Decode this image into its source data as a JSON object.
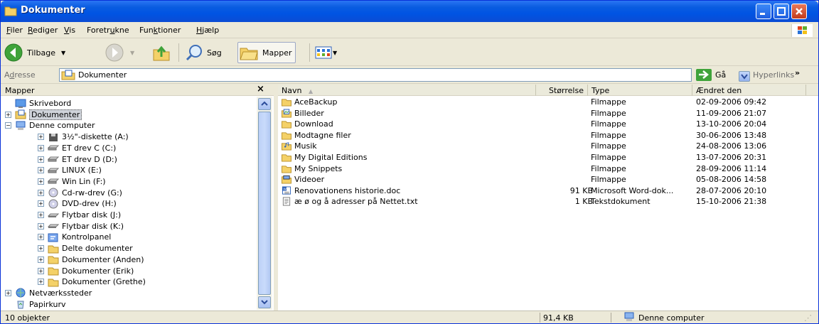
{
  "window": {
    "title": "Dokumenter",
    "colors": {
      "titlebar": "#0054e3",
      "chrome": "#ece9d8",
      "close": "#c23b1b"
    }
  },
  "menu": [
    {
      "label": "Filer",
      "u": "F",
      "rest": "iler"
    },
    {
      "label": "Rediger",
      "u": "R",
      "rest": "ediger"
    },
    {
      "label": "Vis",
      "u": "V",
      "rest": "is"
    },
    {
      "label": "Foretrukne",
      "pre": "Foretr",
      "u": "u",
      "rest": "kne"
    },
    {
      "label": "Funktioner",
      "pre": "Fun",
      "u": "k",
      "rest": "tioner"
    },
    {
      "label": "Hjælp",
      "u": "H",
      "rest": "jælp"
    }
  ],
  "toolbar": {
    "back_label": "Tilbage",
    "search_label": "Søg",
    "folders_label": "Mapper"
  },
  "address": {
    "label_pre": "A",
    "label_u": "d",
    "label_rest": "resse",
    "value": "Dokumenter",
    "go_label": "Gå",
    "links_label": "Hyperlinks",
    "more": "»"
  },
  "folderpane": {
    "title": "Mapper",
    "close": "×",
    "tree": [
      {
        "label": "Skrivebord",
        "icon": "desktop-icon",
        "level": 0,
        "exp": ""
      },
      {
        "label": "Dokumenter",
        "icon": "documents-folder-icon",
        "level": 0,
        "exp": "+",
        "selected": true
      },
      {
        "label": "Denne computer",
        "icon": "my-computer-icon",
        "level": 0,
        "exp": "−"
      },
      {
        "label": "3½\"-diskette (A:)",
        "icon": "floppy-icon",
        "level": 1,
        "exp": "+"
      },
      {
        "label": "ET drev C (C:)",
        "icon": "drive-icon",
        "level": 1,
        "exp": "+"
      },
      {
        "label": "ET drev D (D:)",
        "icon": "drive-icon",
        "level": 1,
        "exp": "+"
      },
      {
        "label": "LINUX (E:)",
        "icon": "drive-icon",
        "level": 1,
        "exp": "+"
      },
      {
        "label": "Win Lin (F:)",
        "icon": "drive-icon",
        "level": 1,
        "exp": "+"
      },
      {
        "label": "Cd-rw-drev (G:)",
        "icon": "cd-drive-icon",
        "level": 1,
        "exp": "+"
      },
      {
        "label": "DVD-drev (H:)",
        "icon": "cd-drive-icon",
        "level": 1,
        "exp": "+"
      },
      {
        "label": "Flytbar disk (J:)",
        "icon": "removable-disk-icon",
        "level": 1,
        "exp": "+"
      },
      {
        "label": "Flytbar disk (K:)",
        "icon": "removable-disk-icon",
        "level": 1,
        "exp": "+"
      },
      {
        "label": "Kontrolpanel",
        "icon": "control-panel-icon",
        "level": 1,
        "exp": "+"
      },
      {
        "label": "Delte dokumenter",
        "icon": "folder-icon",
        "level": 1,
        "exp": "+"
      },
      {
        "label": "Dokumenter (Anden)",
        "icon": "folder-icon",
        "level": 1,
        "exp": "+"
      },
      {
        "label": "Dokumenter (Erik)",
        "icon": "folder-icon",
        "level": 1,
        "exp": "+"
      },
      {
        "label": "Dokumenter (Grethe)",
        "icon": "folder-icon",
        "level": 1,
        "exp": "+"
      },
      {
        "label": "Netværkssteder",
        "icon": "network-places-icon",
        "level": 0,
        "exp": "+"
      },
      {
        "label": "Papirkurv",
        "icon": "recycle-bin-icon",
        "level": 0,
        "exp": ""
      }
    ]
  },
  "filelist": {
    "columns": {
      "name": "Navn",
      "sort_arrow": "▲",
      "size": "Størrelse",
      "type": "Type",
      "date": "Ændret den"
    },
    "rows": [
      {
        "name": "AceBackup",
        "size": "",
        "type": "Filmappe",
        "date": "02-09-2006 09:42",
        "icon": "folder-icon"
      },
      {
        "name": "Billeder",
        "size": "",
        "type": "Filmappe",
        "date": "11-09-2006 21:07",
        "icon": "pictures-folder-icon"
      },
      {
        "name": "Download",
        "size": "",
        "type": "Filmappe",
        "date": "13-10-2006 20:04",
        "icon": "folder-icon"
      },
      {
        "name": "Modtagne filer",
        "size": "",
        "type": "Filmappe",
        "date": "30-06-2006 13:48",
        "icon": "folder-icon"
      },
      {
        "name": "Musik",
        "size": "",
        "type": "Filmappe",
        "date": "24-08-2006 13:06",
        "icon": "music-folder-icon"
      },
      {
        "name": "My Digital Editions",
        "size": "",
        "type": "Filmappe",
        "date": "13-07-2006 20:31",
        "icon": "folder-icon"
      },
      {
        "name": "My Snippets",
        "size": "",
        "type": "Filmappe",
        "date": "28-09-2006 11:14",
        "icon": "folder-icon"
      },
      {
        "name": "Videoer",
        "size": "",
        "type": "Filmappe",
        "date": "05-08-2006 14:58",
        "icon": "videos-folder-icon"
      },
      {
        "name": "Renovationens historie.doc",
        "size": "91 KB",
        "type": "Microsoft Word-dok...",
        "date": "28-07-2006 20:10",
        "icon": "word-doc-icon"
      },
      {
        "name": "æ ø og å adresser på Nettet.txt",
        "size": "1 KB",
        "type": "Tekstdokument",
        "date": "15-10-2006 21:38",
        "icon": "text-file-icon"
      }
    ]
  },
  "status": {
    "count": "10 objekter",
    "size": "91,4 KB",
    "location": "Denne computer"
  }
}
